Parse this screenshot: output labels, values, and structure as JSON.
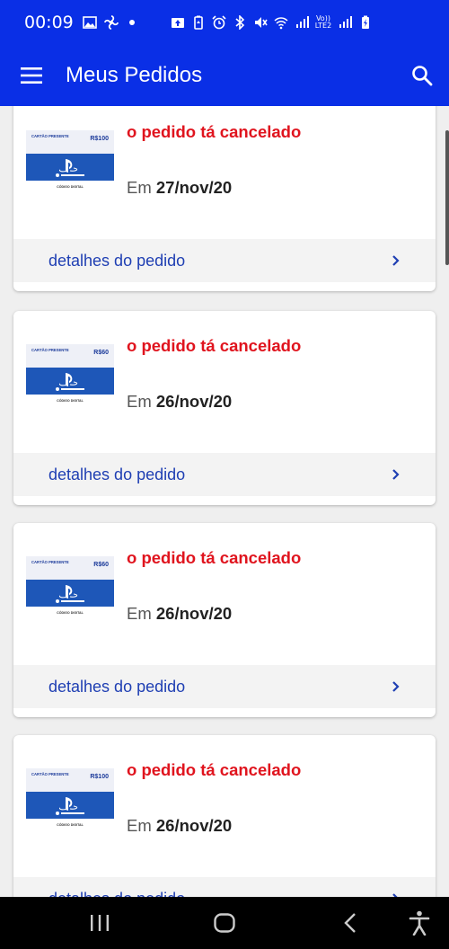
{
  "status_bar": {
    "time": "00:09",
    "icons_left": [
      "image-icon",
      "fan-icon",
      "dot-icon"
    ],
    "icons_right": [
      "upload-icon",
      "battery-saver-icon",
      "alarm-icon",
      "bluetooth-icon",
      "mute-icon",
      "wifi-icon",
      "signal-icon",
      "volte-icon",
      "signal-icon",
      "battery-charging-icon"
    ],
    "volte_top": "Vo))",
    "volte_bottom": "LTE2"
  },
  "app_bar": {
    "title": "Meus Pedidos",
    "menu_icon": "hamburger-menu-icon",
    "search_icon": "search-icon"
  },
  "orders": [
    {
      "status": "o pedido tá cancelado",
      "date_prefix": "Em",
      "date": "27/nov/20",
      "details_label": "detalhes do pedido",
      "card_value": "R$100",
      "card_label": "CARTÃO PRESENTE",
      "card_footer": "CÓDIGO DIGITAL"
    },
    {
      "status": "o pedido tá cancelado",
      "date_prefix": "Em",
      "date": "26/nov/20",
      "details_label": "detalhes do pedido",
      "card_value": "R$60",
      "card_label": "CARTÃO PRESENTE",
      "card_footer": "CÓDIGO DIGITAL"
    },
    {
      "status": "o pedido tá cancelado",
      "date_prefix": "Em",
      "date": "26/nov/20",
      "details_label": "detalhes do pedido",
      "card_value": "R$60",
      "card_label": "CARTÃO PRESENTE",
      "card_footer": "CÓDIGO DIGITAL"
    },
    {
      "status": "o pedido tá cancelado",
      "date_prefix": "Em",
      "date": "26/nov/20",
      "details_label": "detalhes do pedido",
      "card_value": "R$100",
      "card_label": "CARTÃO PRESENTE",
      "card_footer": "CÓDIGO DIGITAL"
    }
  ],
  "nav_bar": {
    "icons": [
      "recent-apps-icon",
      "home-icon",
      "back-icon",
      "accessibility-icon"
    ]
  },
  "colors": {
    "primary": "#0a2fe6",
    "canceled": "#e0141e",
    "link": "#1f3fb3"
  }
}
